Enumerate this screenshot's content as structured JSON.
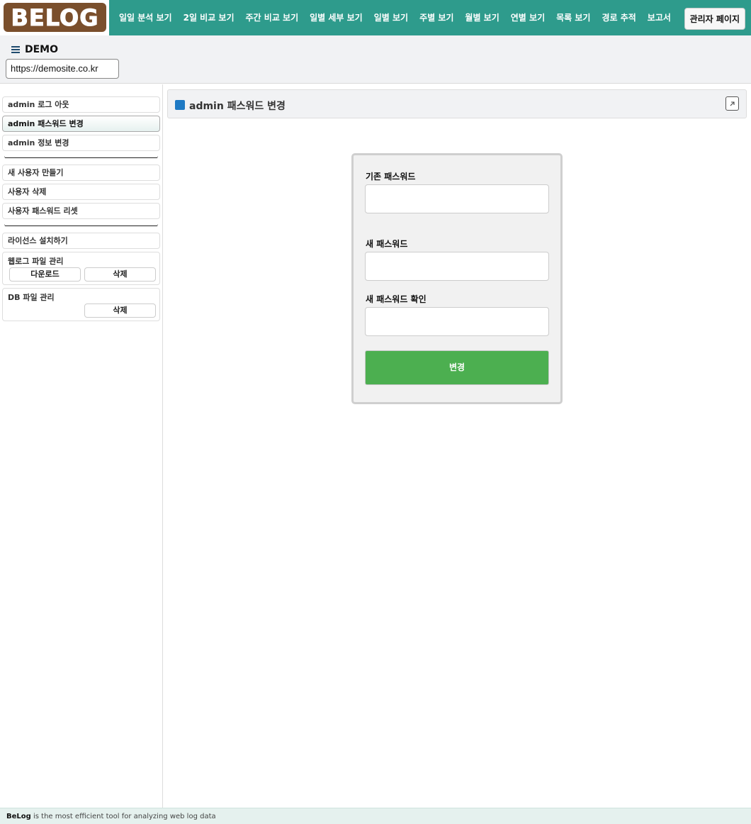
{
  "app": {
    "logo_text": "BELOG"
  },
  "nav": {
    "items": [
      "일일 분석 보기",
      "2일 비교 보기",
      "주간 비교 보기",
      "일별 세부 보기",
      "일별 보기",
      "주별 보기",
      "월별 보기",
      "연별 보기",
      "목록 보기",
      "경로 추적",
      "보고서"
    ],
    "admin_label": "관리자 페이지"
  },
  "site": {
    "title": "DEMO",
    "url": "https://demosite.co.kr"
  },
  "sidebar": {
    "items": [
      {
        "label": "admin 로그 아웃"
      },
      {
        "label": "admin 패스워드 변경",
        "active": true
      },
      {
        "label": "admin 정보 변경"
      },
      {
        "label": "새 사용자 만들기"
      },
      {
        "label": "사용자 삭제"
      },
      {
        "label": "사용자 패스워드 리셋"
      },
      {
        "label": "라이선스 설치하기"
      }
    ],
    "weblog_group": {
      "title": "웹로그 파일 관리",
      "download_label": "다운로드",
      "delete_label": "삭제"
    },
    "db_group": {
      "title": "DB 파일 관리",
      "delete_label": "삭제"
    }
  },
  "panel": {
    "title": "admin 패스워드 변경"
  },
  "form": {
    "old_password_label": "기존 패스워드",
    "new_password_label": "새 패스워드",
    "confirm_password_label": "새 패스워드 확인",
    "submit_label": "변경"
  },
  "footer": {
    "brand": "BeLog",
    "text": " is the most efficient tool for analyzing web log data"
  },
  "colors": {
    "nav_bg": "#2e9b8c",
    "logo_bg": "#7a4f2c",
    "submit_bg": "#4caf50",
    "panel_icon": "#1e7ac4"
  }
}
